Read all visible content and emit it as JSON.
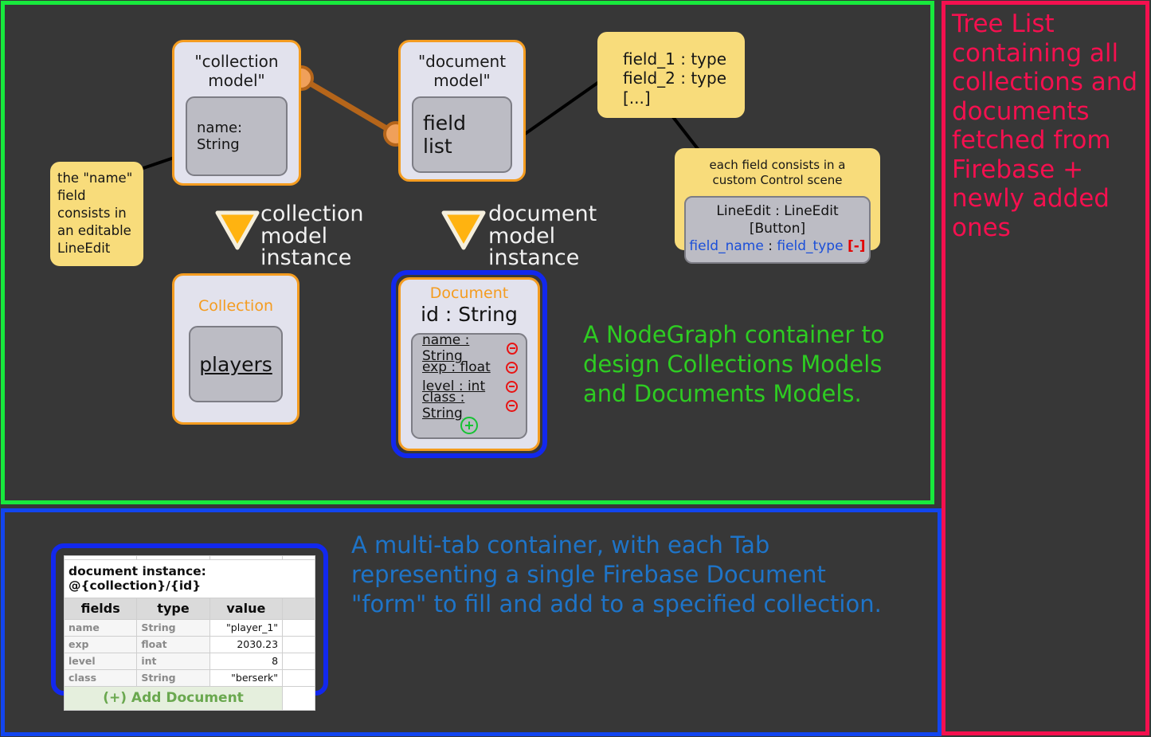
{
  "panels": {
    "nodegraph": {
      "name": "NodeGraph container",
      "border_color": "#18e93d",
      "annotation": "A NodeGraph container to\ndesign Collections Models\nand Documents Models."
    },
    "tabs": {
      "name": "Multi-tab container",
      "border_color": "#1245ef",
      "annotation": "A multi-tab container, with each Tab\nrepresenting a single Firebase Document\n\"form\" to fill and add to a specified collection."
    },
    "tree": {
      "name": "Tree list",
      "border_color": "#f4104f",
      "annotation": "Tree List containing all collections and documents fetched from Firebase + newly added ones"
    }
  },
  "nodes": {
    "collection_model": {
      "title": "\"collection\nmodel\"",
      "inner_text": "name: String",
      "port_icon": "connector-port-icon"
    },
    "document_model": {
      "title": "\"document\nmodel\"",
      "inner_text": "field list",
      "port_icon": "connector-port-icon"
    },
    "collection_instance": {
      "title": "Collection",
      "value": "players"
    },
    "document_instance": {
      "title": "Document",
      "id": "id : String",
      "fields": [
        {
          "label": "name : String",
          "remove_icon": "minus-circle-icon"
        },
        {
          "label": "exp : float",
          "remove_icon": "minus-circle-icon"
        },
        {
          "label": "level : int",
          "remove_icon": "minus-circle-icon"
        },
        {
          "label": "class : String",
          "remove_icon": "minus-circle-icon"
        }
      ],
      "add_icon": "plus-circle-icon"
    }
  },
  "notes": {
    "name_field": "the \"name\" field consists in an editable LineEdit",
    "field_list": "field_1 : type\nfield_2 : type\n[...]",
    "control_scene": {
      "text": "each field consists in a\ncustom Control scene",
      "scene_line1": "LineEdit : LineEdit [Button]",
      "scene_field_name": "field_name",
      "scene_colon": " : ",
      "scene_field_type": "field_type",
      "scene_remove": "[-]"
    }
  },
  "instance_markers": {
    "collection": {
      "label": "collection\nmodel\ninstance",
      "icon": "down-triangle-icon"
    },
    "document": {
      "label": "document\nmodel\ninstance",
      "icon": "down-triangle-icon"
    }
  },
  "doc_form": {
    "title": "document instance: @{collection}/{id}",
    "headers": [
      "fields",
      "type",
      "value",
      ""
    ],
    "rows": [
      {
        "field": "name",
        "type": "String",
        "value": "\"player_1\""
      },
      {
        "field": "exp",
        "type": "float",
        "value": "2030.23"
      },
      {
        "field": "level",
        "type": "int",
        "value": "8"
      },
      {
        "field": "class",
        "type": "String",
        "value": "\"berserk\""
      }
    ],
    "add_label": "(+) Add Document"
  },
  "colors": {
    "background": "#373737",
    "green": "#18e93d",
    "blue": "#1245ef",
    "pink": "#f4104f",
    "orange": "#f49c20",
    "note_yellow": "#f8dc7b",
    "node_bg": "#e2e2ed",
    "inner_bg": "#bcbcc4",
    "wire": "#b5651a",
    "annotation_green": "#2ecc22",
    "annotation_blue": "#1e74c8"
  }
}
